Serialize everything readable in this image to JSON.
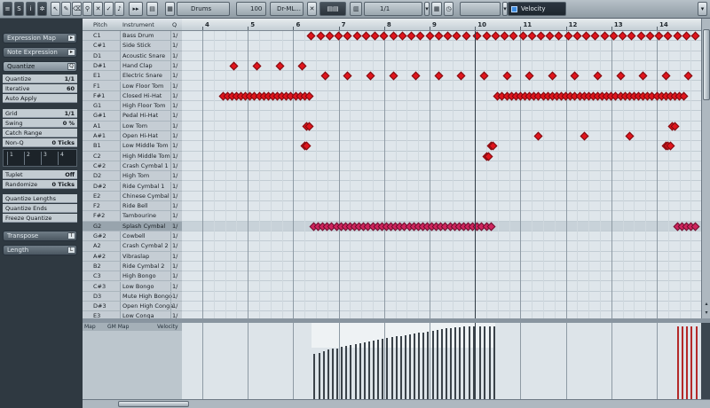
{
  "toolbar": {
    "drum_map": "Drums",
    "volume": "100",
    "output": "Dr-ML...",
    "quantize": "1/1",
    "lane": "Velocity"
  },
  "inspector": {
    "expression_map": "Expression Map",
    "note_expression": "Note Expression",
    "quantize_section": "Quantize",
    "quantize_label": "Quantize",
    "quantize_value": "1/1",
    "iterative_label": "Iterative",
    "iterative_value": "60",
    "auto_apply": "Auto Apply",
    "grid_label": "Grid",
    "grid_value": "1/1",
    "swing_label": "Swing",
    "swing_value": "0 %",
    "catch_range": "Catch Range",
    "non_q_label": "Non-Q",
    "non_q_value": "0 Ticks",
    "tuplet_label": "Tuplet",
    "tuplet_value": "Off",
    "randomize_label": "Randomize",
    "randomize_value": "0 Ticks",
    "quantize_lengths": "Quantize Lengths",
    "quantize_ends": "Quantize Ends",
    "freeze_quantize": "Freeze Quantize",
    "transpose": "Transpose",
    "length": "Length",
    "qgrid": [
      "1",
      "2",
      "3",
      "4"
    ]
  },
  "list_header": {
    "pitch": "Pitch",
    "instrument": "Instrument",
    "q": "Q"
  },
  "drums": [
    {
      "pitch": "C1",
      "inst": "Bass Drum",
      "q": "1/"
    },
    {
      "pitch": "C#1",
      "inst": "Side Stick",
      "q": "1/"
    },
    {
      "pitch": "D1",
      "inst": "Acoustic Snare",
      "q": "1/"
    },
    {
      "pitch": "D#1",
      "inst": "Hand Clap",
      "q": "1/"
    },
    {
      "pitch": "E1",
      "inst": "Electric Snare",
      "q": "1/"
    },
    {
      "pitch": "F1",
      "inst": "Low Floor Tom",
      "q": "1/"
    },
    {
      "pitch": "F#1",
      "inst": "Closed Hi-Hat",
      "q": "1/"
    },
    {
      "pitch": "G1",
      "inst": "High Floor Tom",
      "q": "1/"
    },
    {
      "pitch": "G#1",
      "inst": "Pedal Hi-Hat",
      "q": "1/"
    },
    {
      "pitch": "A1",
      "inst": "Low Tom",
      "q": "1/"
    },
    {
      "pitch": "A#1",
      "inst": "Open Hi-Hat",
      "q": "1/"
    },
    {
      "pitch": "B1",
      "inst": "Low Middle Tom",
      "q": "1/"
    },
    {
      "pitch": "C2",
      "inst": "High Middle Tom",
      "q": "1/"
    },
    {
      "pitch": "C#2",
      "inst": "Crash Cymbal 1",
      "q": "1/"
    },
    {
      "pitch": "D2",
      "inst": "High Tom",
      "q": "1/"
    },
    {
      "pitch": "D#2",
      "inst": "Ride Cymbal 1",
      "q": "1/"
    },
    {
      "pitch": "E2",
      "inst": "Chinese Cymbal",
      "q": "1/"
    },
    {
      "pitch": "F2",
      "inst": "Ride Bell",
      "q": "1/"
    },
    {
      "pitch": "F#2",
      "inst": "Tambourine",
      "q": "1/"
    },
    {
      "pitch": "G2",
      "inst": "Splash Cymbal",
      "q": "1/"
    },
    {
      "pitch": "G#2",
      "inst": "Cowbell",
      "q": "1/"
    },
    {
      "pitch": "A2",
      "inst": "Crash Cymbal 2",
      "q": "1/"
    },
    {
      "pitch": "A#2",
      "inst": "Vibraslap",
      "q": "1/"
    },
    {
      "pitch": "B2",
      "inst": "Ride Cymbal 2",
      "q": "1/"
    },
    {
      "pitch": "C3",
      "inst": "High Bongo",
      "q": "1/"
    },
    {
      "pitch": "C#3",
      "inst": "Low Bongo",
      "q": "1/"
    },
    {
      "pitch": "D3",
      "inst": "Mute High Bongo",
      "q": "1/"
    },
    {
      "pitch": "D#3",
      "inst": "Open High Conga",
      "q": "1/"
    },
    {
      "pitch": "E3",
      "inst": "Low Conga",
      "q": "1/"
    }
  ],
  "selected_row": 19,
  "ruler": {
    "bars": [
      "4",
      "5",
      "6",
      "7",
      "8",
      "9",
      "10",
      "11",
      "12",
      "13",
      "14"
    ]
  },
  "playhead_bar": 10.0,
  "notes": [
    {
      "row": 0,
      "pos": [
        6.4,
        6.6,
        6.8,
        7.0,
        7.2,
        7.4,
        7.6,
        7.8,
        8.0,
        8.2,
        8.4,
        8.6,
        8.8,
        9.0,
        9.2,
        9.4,
        9.6,
        9.8,
        10.05,
        10.25,
        10.45,
        10.65,
        10.85,
        11.05,
        11.25,
        11.45,
        11.65,
        11.85,
        12.05,
        12.25,
        12.45,
        12.65,
        12.85,
        13.05,
        13.25,
        13.45,
        13.65,
        13.85,
        14.05,
        14.25,
        14.45,
        14.65,
        14.85
      ]
    },
    {
      "row": 3,
      "pos": [
        4.7,
        5.2,
        5.7,
        6.2
      ]
    },
    {
      "row": 4,
      "pos": [
        6.7,
        7.2,
        7.7,
        8.2,
        8.7,
        9.2,
        9.7,
        10.2,
        10.7,
        11.2,
        11.7,
        12.2,
        12.7,
        13.2,
        13.7,
        14.2,
        14.7
      ]
    },
    {
      "row": 6,
      "pos": [
        4.45,
        4.55,
        4.65,
        4.75,
        4.85,
        4.95,
        5.05,
        5.15,
        5.25,
        5.35,
        5.45,
        5.55,
        5.65,
        5.75,
        5.85,
        5.95,
        6.05,
        6.15,
        6.25,
        6.35,
        10.5,
        10.6,
        10.7,
        10.8,
        10.9,
        11.0,
        11.1,
        11.2,
        11.3,
        11.4,
        11.5,
        11.6,
        11.7,
        11.8,
        11.9,
        12.0,
        12.1,
        12.2,
        12.3,
        12.4,
        12.5,
        12.6,
        12.7,
        12.8,
        12.9,
        13.0,
        13.1,
        13.2,
        13.3,
        13.4,
        13.5,
        13.6,
        13.7,
        13.8,
        13.9,
        14.0,
        14.1,
        14.2,
        14.3,
        14.4,
        14.5,
        14.6
      ]
    },
    {
      "row": 9,
      "pos": [
        6.3,
        6.35,
        14.35,
        14.4
      ]
    },
    {
      "row": 10,
      "pos": [
        11.4,
        12.4,
        13.4
      ]
    },
    {
      "row": 11,
      "pos": [
        6.25,
        6.3,
        10.35,
        10.4,
        14.2,
        14.25,
        14.3
      ]
    },
    {
      "row": 12,
      "pos": [
        10.25,
        10.3
      ]
    },
    {
      "row": 19,
      "pos": [
        6.45,
        6.55,
        6.65,
        6.75,
        6.85,
        6.95,
        7.05,
        7.15,
        7.25,
        7.35,
        7.45,
        7.55,
        7.65,
        7.75,
        7.85,
        7.95,
        8.05,
        8.15,
        8.25,
        8.35,
        8.45,
        8.55,
        8.65,
        8.75,
        8.85,
        8.95,
        9.05,
        9.15,
        9.25,
        9.35,
        9.45,
        9.55,
        9.65,
        9.75,
        9.85,
        9.95,
        10.05,
        10.15,
        10.25,
        10.35,
        14.45,
        14.55,
        14.65,
        14.75,
        14.85
      ],
      "color": "pink"
    }
  ],
  "lane": {
    "map_label": "Map",
    "gm_map": "GM Map",
    "velocity_label": "Velocity",
    "bars": [
      {
        "pos": 6.45,
        "vel": 0.62
      },
      {
        "pos": 6.55,
        "vel": 0.64
      },
      {
        "pos": 6.65,
        "vel": 0.66
      },
      {
        "pos": 6.75,
        "vel": 0.68
      },
      {
        "pos": 6.85,
        "vel": 0.69
      },
      {
        "pos": 6.95,
        "vel": 0.7
      },
      {
        "pos": 7.05,
        "vel": 0.72
      },
      {
        "pos": 7.15,
        "vel": 0.73
      },
      {
        "pos": 7.25,
        "vel": 0.74
      },
      {
        "pos": 7.35,
        "vel": 0.76
      },
      {
        "pos": 7.45,
        "vel": 0.77
      },
      {
        "pos": 7.55,
        "vel": 0.78
      },
      {
        "pos": 7.65,
        "vel": 0.79
      },
      {
        "pos": 7.75,
        "vel": 0.8
      },
      {
        "pos": 7.85,
        "vel": 0.82
      },
      {
        "pos": 7.95,
        "vel": 0.83
      },
      {
        "pos": 8.05,
        "vel": 0.84
      },
      {
        "pos": 8.15,
        "vel": 0.85
      },
      {
        "pos": 8.25,
        "vel": 0.86
      },
      {
        "pos": 8.35,
        "vel": 0.87
      },
      {
        "pos": 8.45,
        "vel": 0.88
      },
      {
        "pos": 8.55,
        "vel": 0.89
      },
      {
        "pos": 8.65,
        "vel": 0.9
      },
      {
        "pos": 8.75,
        "vel": 0.91
      },
      {
        "pos": 8.85,
        "vel": 0.92
      },
      {
        "pos": 8.95,
        "vel": 0.93
      },
      {
        "pos": 9.05,
        "vel": 0.94
      },
      {
        "pos": 9.15,
        "vel": 0.95
      },
      {
        "pos": 9.25,
        "vel": 0.96
      },
      {
        "pos": 9.35,
        "vel": 0.97
      },
      {
        "pos": 9.45,
        "vel": 0.98
      },
      {
        "pos": 9.55,
        "vel": 0.99
      },
      {
        "pos": 9.65,
        "vel": 0.99
      },
      {
        "pos": 9.75,
        "vel": 1.0
      },
      {
        "pos": 9.85,
        "vel": 1.0
      },
      {
        "pos": 9.95,
        "vel": 1.0
      },
      {
        "pos": 10.1,
        "vel": 1.0
      },
      {
        "pos": 10.2,
        "vel": 1.0
      },
      {
        "pos": 10.3,
        "vel": 1.0
      },
      {
        "pos": 10.4,
        "vel": 1.0
      }
    ],
    "red_bars": [
      {
        "pos": 14.45,
        "vel": 1.0
      },
      {
        "pos": 14.55,
        "vel": 1.0
      },
      {
        "pos": 14.65,
        "vel": 1.0
      },
      {
        "pos": 14.75,
        "vel": 1.0
      },
      {
        "pos": 14.85,
        "vel": 1.0
      }
    ]
  }
}
